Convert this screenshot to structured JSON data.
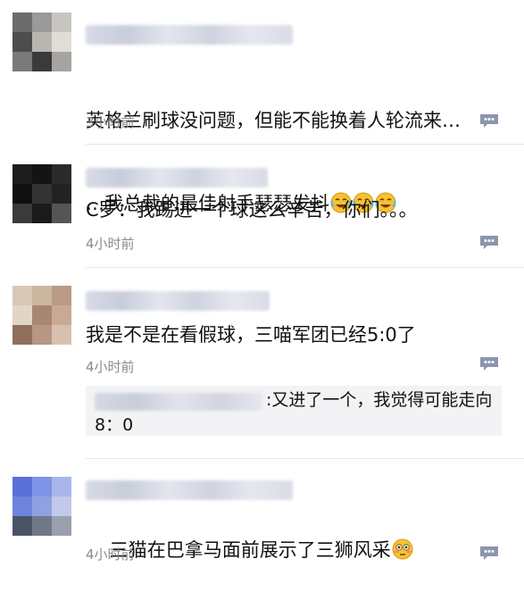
{
  "comments": [
    {
      "text": "英格兰刷球没问题，但能不能换着人轮流来…",
      "text2": "…我总裁的最佳射手瑟瑟发抖",
      "time": "3小时前",
      "emoji": "laughing-crying-face",
      "emoji_count": 3
    },
    {
      "text": "C罗：我踢进一个球这么辛苦，你们。。。",
      "time": "4小时前"
    },
    {
      "text": "我是不是在看假球，三喵军团已经5:0了",
      "time": "4小时前",
      "reply": {
        "text": ":又进了一个，我觉得可能走向8：0"
      }
    },
    {
      "text": "三猫在巴拿马面前展示了三狮风采",
      "time": "4小时前",
      "emoji": "flushed-face"
    }
  ],
  "colors": {
    "time": "#8a8a8a",
    "reply_icon": "#8b95ad",
    "separator": "#e6e6e6",
    "reply_bg": "#f3f3f5"
  }
}
